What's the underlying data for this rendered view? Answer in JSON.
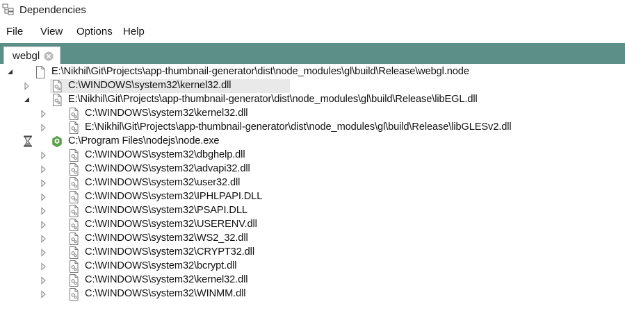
{
  "window": {
    "title": "Dependencies"
  },
  "menu": [
    "File",
    "View",
    "Options",
    "Help"
  ],
  "tab": {
    "label": "webgl"
  },
  "tree": [
    {
      "label": "E:\\Nikhil\\Git\\Projects\\app-thumbnail-generator\\dist\\node_modules\\gl\\build\\Release\\webgl.node",
      "level": 0,
      "expander": "expanded",
      "icon": "file-blank-icon"
    },
    {
      "label": "C:\\WINDOWS\\system32\\kernel32.dll",
      "level": 1,
      "expander": "collapsed",
      "icon": "dll-file-icon",
      "selected": true
    },
    {
      "label": "E:\\Nikhil\\Git\\Projects\\app-thumbnail-generator\\dist\\node_modules\\gl\\build\\Release\\libEGL.dll",
      "level": 1,
      "expander": "expanded",
      "icon": "dll-file-icon"
    },
    {
      "label": "C:\\WINDOWS\\system32\\kernel32.dll",
      "level": 2,
      "expander": "collapsed",
      "icon": "dll-file-icon"
    },
    {
      "label": "E:\\Nikhil\\Git\\Projects\\app-thumbnail-generator\\dist\\node_modules\\gl\\build\\Release\\libGLESv2.dll",
      "level": 2,
      "expander": "collapsed",
      "icon": "dll-file-icon"
    },
    {
      "label": "C:\\Program Files\\nodejs\\node.exe",
      "level": 1,
      "expander": "loading",
      "icon": "nodejs-icon"
    },
    {
      "label": "C:\\WINDOWS\\system32\\dbghelp.dll",
      "level": 2,
      "expander": "collapsed",
      "icon": "dll-file-icon"
    },
    {
      "label": "C:\\WINDOWS\\system32\\advapi32.dll",
      "level": 2,
      "expander": "collapsed",
      "icon": "dll-file-icon"
    },
    {
      "label": "C:\\WINDOWS\\system32\\user32.dll",
      "level": 2,
      "expander": "collapsed",
      "icon": "dll-file-icon"
    },
    {
      "label": "C:\\WINDOWS\\system32\\IPHLPAPI.DLL",
      "level": 2,
      "expander": "collapsed",
      "icon": "dll-file-icon"
    },
    {
      "label": "C:\\WINDOWS\\system32\\PSAPI.DLL",
      "level": 2,
      "expander": "collapsed",
      "icon": "dll-file-icon"
    },
    {
      "label": "C:\\WINDOWS\\system32\\USERENV.dll",
      "level": 2,
      "expander": "collapsed",
      "icon": "dll-file-icon"
    },
    {
      "label": "C:\\WINDOWS\\system32\\WS2_32.dll",
      "level": 2,
      "expander": "collapsed",
      "icon": "dll-file-icon"
    },
    {
      "label": "C:\\WINDOWS\\system32\\CRYPT32.dll",
      "level": 2,
      "expander": "collapsed",
      "icon": "dll-file-icon"
    },
    {
      "label": "C:\\WINDOWS\\system32\\bcrypt.dll",
      "level": 2,
      "expander": "collapsed",
      "icon": "dll-file-icon"
    },
    {
      "label": "C:\\WINDOWS\\system32\\kernel32.dll",
      "level": 2,
      "expander": "collapsed",
      "icon": "dll-file-icon"
    },
    {
      "label": "C:\\WINDOWS\\system32\\WINMM.dll",
      "level": 2,
      "expander": "collapsed",
      "icon": "dll-file-icon"
    }
  ],
  "colors": {
    "tabstrip": "#5b8f88",
    "selection": "#e9e9e9",
    "nodejs": "#5fa04e"
  }
}
